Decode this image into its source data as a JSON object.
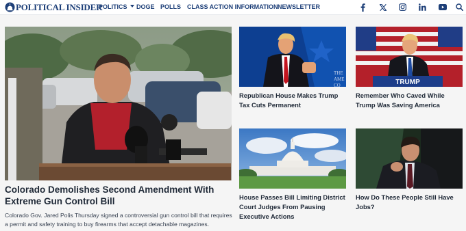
{
  "site": {
    "logo_text": "POLITICAL INSIDER",
    "accent_color": "#1d3f78"
  },
  "nav": {
    "items": [
      {
        "label": "POLITICS",
        "has_dropdown": true
      },
      {
        "label": "DOGE"
      },
      {
        "label": "POLLS"
      },
      {
        "label": "CLASS ACTION INFORMATION"
      },
      {
        "label": "NEWSLETTER"
      }
    ],
    "social_icons": [
      "facebook-icon",
      "x-icon",
      "instagram-icon",
      "linkedin-icon",
      "youtube-icon",
      "search-icon"
    ]
  },
  "hero": {
    "title": "Colorado Demolishes Second Amendment With Extreme Gun Control Bill",
    "excerpt": "Colorado Gov. Jared Polis Thursday signed a controversial gun control bill that requires a permit and safety training to buy firearms that accept detachable magazines."
  },
  "cards": [
    {
      "title": "Republican House Makes Trump Tax Cuts Permanent"
    },
    {
      "title": "Remember Who Caved While Trump Was Saving America"
    },
    {
      "title": "House Passes Bill Limiting District Court Judges From Pausing Executive Actions"
    },
    {
      "title": "How Do These People Still Have Jobs?"
    }
  ],
  "image_text": {
    "podium_lettering": "THE AME CO",
    "banner_lettering": "TRUMP"
  }
}
